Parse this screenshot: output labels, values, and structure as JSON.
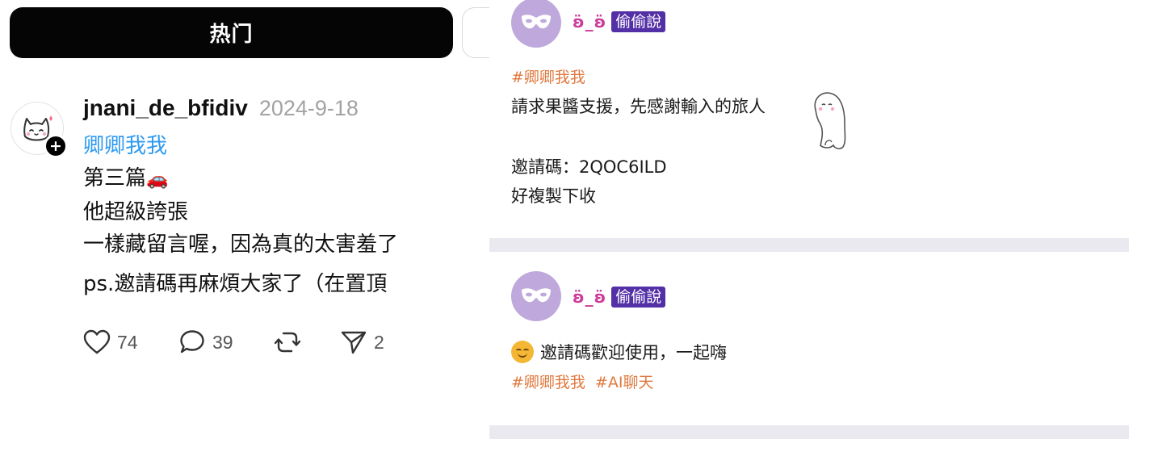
{
  "tabs": {
    "active_label": "热门"
  },
  "post": {
    "username": "jnani_de_bfidiv",
    "date": "2024-9-18",
    "tag": "卿卿我我",
    "lines": [
      "第三篇",
      "他超級誇張",
      "一樣藏留言喔，因為真的太害羞了",
      "ps.邀請碼再麻煩大家了（在置頂"
    ],
    "car_emoji": "🚗",
    "likes": "74",
    "comments": "39",
    "shares": "2",
    "icons": [
      "heart-icon",
      "comment-icon",
      "repost-icon",
      "share-icon",
      "cat-avatar-icon",
      "plus-icon"
    ]
  },
  "feed": {
    "cards": [
      {
        "nickname": "ʚ̈_ʚ̈",
        "badge": "偷偷說",
        "tags": [
          "#卿卿我我"
        ],
        "lines": [
          "請求果醬支援，先感謝輸入的旅人",
          "",
          "邀請碼：2QOC6ILD",
          "好複製下收"
        ]
      },
      {
        "nickname": "ʚ̈_ʚ̈",
        "badge": "偷偷說",
        "line": "邀請碼歡迎使用，一起嗨",
        "tags": [
          "#卿卿我我",
          "#AI聊天"
        ]
      }
    ],
    "colors": {
      "tag": "#e0783e",
      "badge": "#5430a6",
      "nickname": "#cc3c9a",
      "avatar": "#bfa8dc",
      "divider": "#ebe9f0"
    }
  }
}
